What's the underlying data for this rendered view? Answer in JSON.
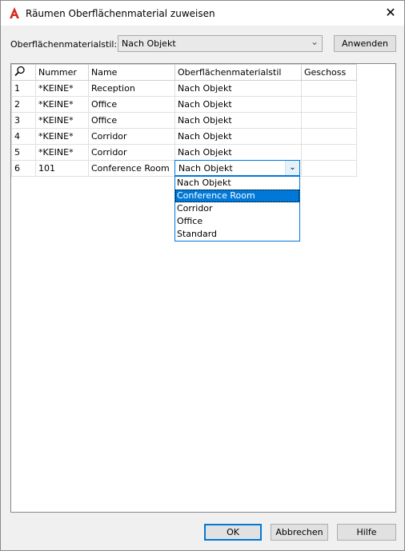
{
  "window": {
    "title": "Räumen Oberflächenmaterial zuweisen",
    "close_glyph": "✕"
  },
  "style_row": {
    "label": "Oberflächenmaterialstil:",
    "selected": "Nach Objekt",
    "apply_label": "Anwenden"
  },
  "table": {
    "headers": [
      "",
      "Nummer",
      "Name",
      "Oberflächenmaterialstil",
      "Geschoss"
    ],
    "rows": [
      {
        "idx": "1",
        "number": "*KEINE*",
        "name": "Reception",
        "style": "Nach Objekt",
        "floor": ""
      },
      {
        "idx": "2",
        "number": "*KEINE*",
        "name": "Office",
        "style": "Nach Objekt",
        "floor": ""
      },
      {
        "idx": "3",
        "number": "*KEINE*",
        "name": "Office",
        "style": "Nach Objekt",
        "floor": ""
      },
      {
        "idx": "4",
        "number": "*KEINE*",
        "name": "Corridor",
        "style": "Nach Objekt",
        "floor": ""
      },
      {
        "idx": "5",
        "number": "*KEINE*",
        "name": "Corridor",
        "style": "Nach Objekt",
        "floor": ""
      },
      {
        "idx": "6",
        "number": "101",
        "name": "Conference Room",
        "style": "Nach Objekt",
        "floor": ""
      }
    ]
  },
  "dropdown": {
    "current": "Nach Objekt",
    "options": [
      "Nach Objekt",
      "Conference Room",
      "Corridor",
      "Office",
      "Standard"
    ],
    "highlighted": "Conference Room"
  },
  "footer": {
    "ok_label": "OK",
    "cancel_label": "Abbrechen",
    "help_label": "Hilfe"
  },
  "colors": {
    "accent": "#0078d7",
    "app_icon_red": "#d7261e"
  }
}
